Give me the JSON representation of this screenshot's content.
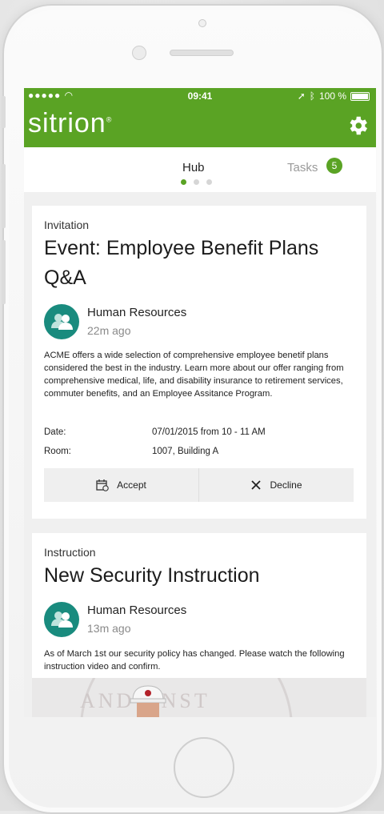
{
  "status_bar": {
    "signal": "●●●●● ",
    "wifi_icon": "wifi-icon",
    "time": "09:41",
    "battery": "100 %"
  },
  "app_bar": {
    "logo": "sitrion",
    "trademark": "®",
    "settings_icon": "gear-icon",
    "accent_color": "#5aa324"
  },
  "tabs": [
    {
      "label": "Hub",
      "active": true
    },
    {
      "label": "Tasks",
      "badge": "5",
      "active": false
    }
  ],
  "pager": {
    "count": 3,
    "active_index": 0
  },
  "cards": [
    {
      "type": "Invitation",
      "title": "Event: Employee Benefit Plans Q&A",
      "author": "Human Resources",
      "time_ago": "22m ago",
      "description": "ACME offers a wide selection of comprehensive employee benetif plans considered the best in the industry. Learn more about our offer ranging from comprehensive medical, life, and disability insurance to retirement services, commuter benefits, and an Employee Assitance Program.",
      "details": [
        {
          "label": "Date:",
          "value": "07/01/2015 from 10 - 11 AM"
        },
        {
          "label": "Room:",
          "value": "1007, Building A"
        }
      ],
      "actions": [
        {
          "label": "Accept",
          "icon": "calendar-accept-icon"
        },
        {
          "label": "Decline",
          "icon": "close-icon"
        }
      ]
    },
    {
      "type": "Instruction",
      "title": "New Security Instruction",
      "author": "Human Resources",
      "time_ago": "13m ago",
      "description": "As of March 1st our security policy has changed. Please watch the following instruction video and confirm.",
      "video_stamp_text": "AND ONST"
    }
  ]
}
